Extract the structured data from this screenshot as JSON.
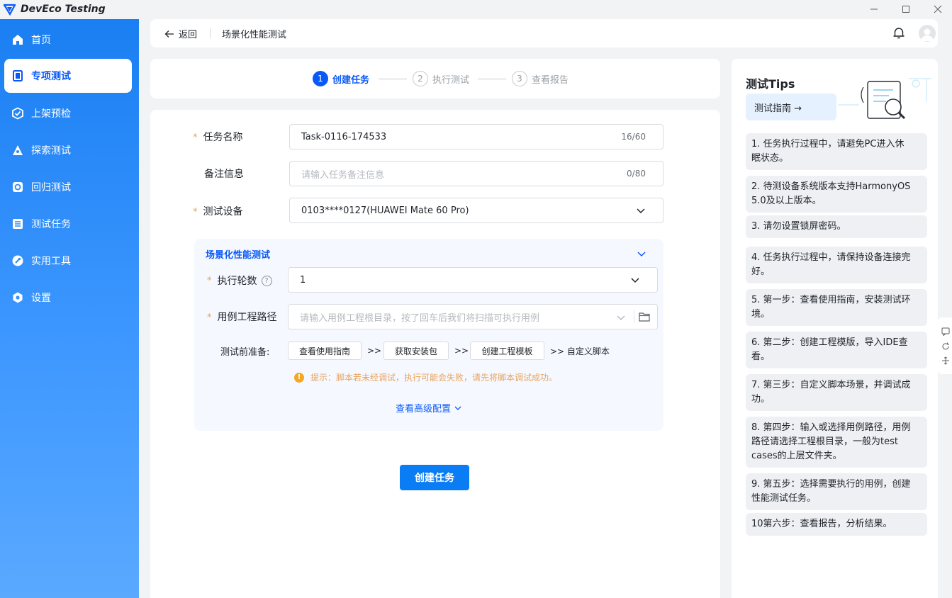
{
  "app": {
    "title": "DevEco Testing"
  },
  "window": {
    "minimize": "—",
    "maximize": "☐",
    "close": "✕"
  },
  "sidebar": {
    "items": [
      {
        "label": "首页",
        "icon": "home-icon"
      },
      {
        "label": "专项测试",
        "icon": "device-icon",
        "active": true
      },
      {
        "label": "上架预检",
        "icon": "shield-check-icon"
      },
      {
        "label": "探索测试",
        "icon": "explore-icon"
      },
      {
        "label": "回归测试",
        "icon": "regression-icon"
      },
      {
        "label": "测试任务",
        "icon": "task-list-icon"
      },
      {
        "label": "实用工具",
        "icon": "tool-icon"
      },
      {
        "label": "设置",
        "icon": "gear-icon"
      }
    ]
  },
  "header": {
    "back_label": "返回",
    "breadcrumb": "场景化性能测试"
  },
  "steps": [
    {
      "num": "1",
      "label": "创建任务",
      "state": "active"
    },
    {
      "num": "2",
      "label": "执行测试",
      "state": "todo"
    },
    {
      "num": "3",
      "label": "查看报告",
      "state": "todo"
    }
  ],
  "form": {
    "task_name": {
      "label": "任务名称",
      "required_mark": "*",
      "value": "Task-0116-174533",
      "counter": "16/60"
    },
    "remark": {
      "label": "备注信息",
      "placeholder": "请输入任务备注信息",
      "counter": "0/80"
    },
    "device": {
      "label": "测试设备",
      "required_mark": "*",
      "value": "0103****0127(HUAWEI Mate 60 Pro)"
    },
    "panel": {
      "title": "场景化性能测试",
      "rounds": {
        "label": "执行轮数",
        "required_mark": "*",
        "help": "?",
        "value": "1"
      },
      "case_path": {
        "label": "用例工程路径",
        "required_mark": "*",
        "placeholder": "请输入用例工程根目录，按了回车后我们将扫描可执行用例"
      },
      "prep": {
        "label": "测试前准备:",
        "btn_guide": "查看使用指南",
        "btn_package": "获取安装包",
        "btn_template": "创建工程模板",
        "sep": ">>",
        "custom_script": ">> 自定义脚本"
      },
      "warning_icon": "!",
      "warning": "提示：脚本若未经调试，执行可能会失败，请先将脚本调试成功。",
      "advanced": "查看高级配置"
    },
    "submit": "创建任务"
  },
  "tips": {
    "title": "测试Tips",
    "guide_button": "测试指南 →",
    "items": [
      [
        "1. 任务执行过程中，请避免PC进入休",
        "眠状态。"
      ],
      [
        "2. 待测设备系统版本支持HarmonyOS",
        "5.0及以上版本。"
      ],
      [
        "3. 请勿设置锁屏密码。"
      ],
      [
        "4. 任务执行过程中，请保持设备连接完",
        "好。"
      ],
      [
        "5. 第一步：查看使用指南，安装测试环",
        "境。"
      ],
      [
        "6. 第二步：创建工程模版，导入IDE查",
        "看。"
      ],
      [
        "7. 第三步：自定义脚本场景，并调试成",
        "功。"
      ],
      [
        "8. 第四步：输入或选择用例路径，用例",
        "路径请选择工程根目录，一般为test",
        "cases的上层文件夹。"
      ],
      [
        "9. 第五步：选择需要执行的用例，创建",
        "性能测试任务。"
      ],
      [
        "10第六步：查看报告，分析结果。"
      ]
    ]
  },
  "colors": {
    "accent": "#0a59f7",
    "sidebar_top": "#1a7ff2",
    "warning": "#e8a25c"
  }
}
